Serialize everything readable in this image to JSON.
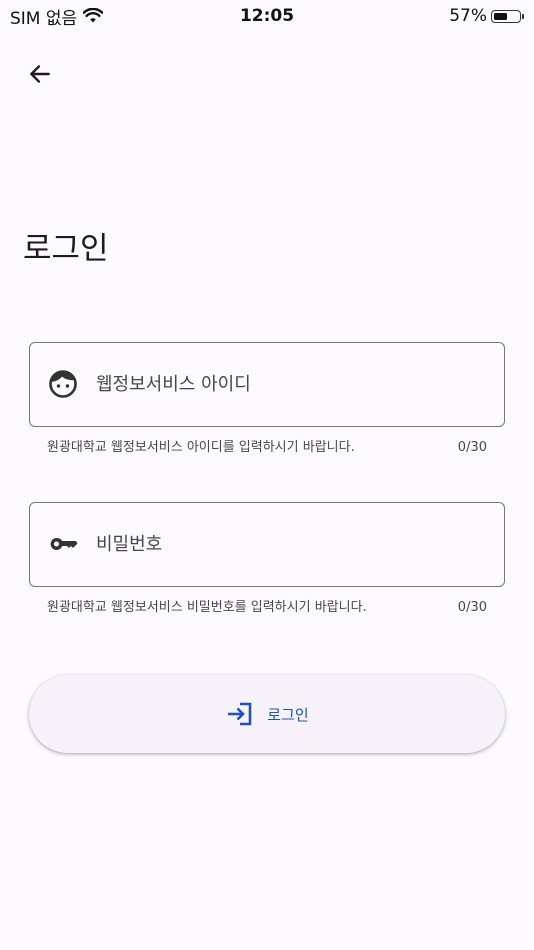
{
  "status_bar": {
    "carrier": "SIM 없음",
    "time": "12:05",
    "battery_percent": "57%",
    "battery_level": 0.57
  },
  "header": {
    "back_icon": "arrow-left-icon",
    "title": "로그인"
  },
  "form": {
    "id_field": {
      "icon": "face-icon",
      "placeholder": "웹정보서비스 아이디",
      "value": "",
      "helper": "원광대학교 웹정보서비스 아이디를 입력하시기 바랍니다.",
      "counter": "0/30"
    },
    "password_field": {
      "icon": "key-icon",
      "placeholder": "비밀번호",
      "value": "",
      "helper": "원광대학교 웹정보서비스 비밀번호를 입력하시기 바랍니다.",
      "counter": "0/30"
    },
    "login_button": {
      "icon": "login-icon",
      "label": "로그인"
    }
  },
  "colors": {
    "background": "#fcf9ff",
    "accent": "#1e55b3",
    "outline": "#79747e",
    "text": "#1d1b20",
    "button_surface": "#f7f2fa"
  }
}
